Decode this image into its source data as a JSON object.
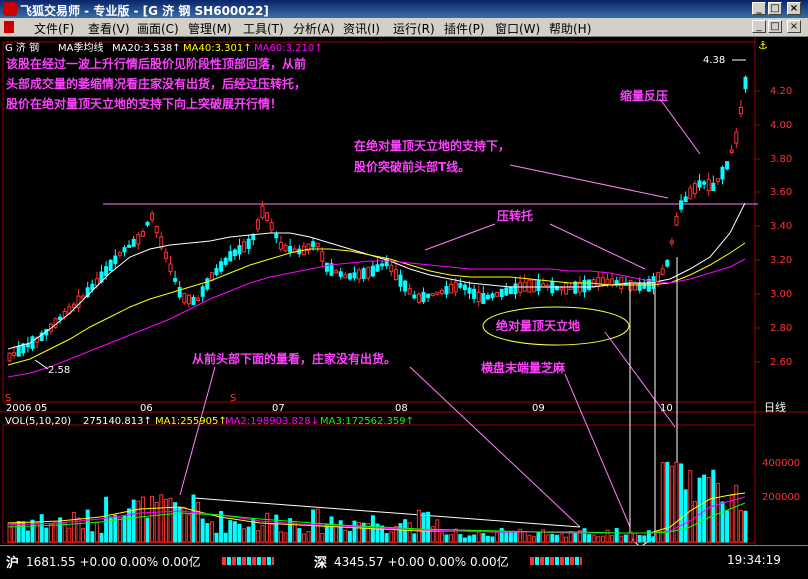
{
  "window": {
    "title": "飞狐交易师 - 专业版 - [G 济 钢 SH600022]"
  },
  "menu": [
    "文件(F)",
    "查看(V)",
    "画面(C)",
    "管理(M)",
    "工具(T)",
    "分析(A)",
    "资讯(I)",
    "运行(R)",
    "插件(P)",
    "窗口(W)",
    "帮助(H)"
  ],
  "header": {
    "stock": "G 济  钢",
    "ma_label": "MA季均线",
    "ma20": "MA20:3.538↑",
    "ma40": "MA40:3.301↑",
    "ma60": "MA60:3.210↑"
  },
  "annotations": {
    "main_text_1": "该股在经过一波上升行情后股价见阶段性顶部回落，从前",
    "main_text_2": "头部成交量的萎缩情况看庄家没有出货，后经过压转托，",
    "main_text_3": "股价在绝对量顶天立地的支持下向上突破展开行情！",
    "breakout_1": "在绝对量顶天立地的支持下，",
    "breakout_2": "股价突破前头部T线。",
    "shrink": "缩量反压",
    "resist": "压转托",
    "absolute": "绝对量顶天立地",
    "vol_note": "从前头部下面的量看，庄家没有出货。",
    "sideways": "横盘末端量芝麻"
  },
  "price_axis": {
    "ticks": [
      "4.20",
      "4.00",
      "3.80",
      "3.60",
      "3.40",
      "3.20",
      "3.00",
      "2.80",
      "2.60"
    ],
    "high_label": "4.38",
    "low_label": "2.58"
  },
  "time_axis": {
    "labels": [
      "2006 05",
      "06",
      "07",
      "08",
      "09",
      "10"
    ],
    "period": "日线"
  },
  "vol_header": {
    "label": "VOL(5,10,20)",
    "value": "275140.813↑",
    "ma1": "MA1:255905↑",
    "ma2": "MA2:198903.828↓",
    "ma3": "MA3:172562.359↑"
  },
  "vol_axis": {
    "ticks": [
      "400000",
      "200000"
    ]
  },
  "status": {
    "sh_label": "沪",
    "sh_text": "1681.55 +0.00 0.00% 0.00亿",
    "sz_label": "深",
    "sz_text": "4345.57 +0.00 0.00% 0.00亿",
    "time": "19:34:19"
  },
  "colors": {
    "up": "#ff3030",
    "down": "#00ffff",
    "annotation": "#ff40ff",
    "ma20": "#ffffff",
    "ma40": "#ffff00",
    "ma60": "#ff00ff",
    "bg": "#000000"
  }
}
